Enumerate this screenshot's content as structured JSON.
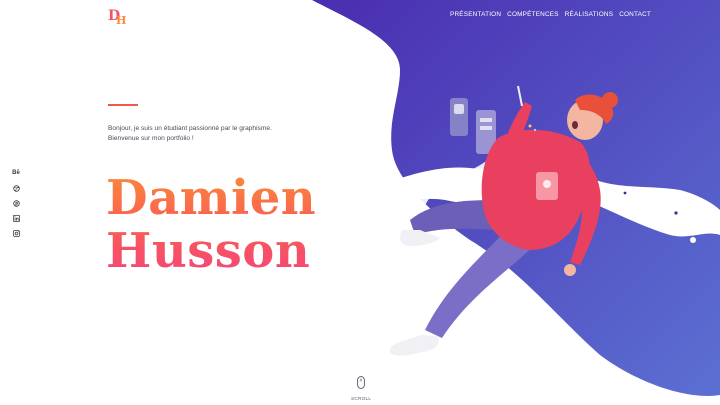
{
  "logo": {
    "icon": "dh-monogram-logo"
  },
  "nav": {
    "items": [
      "PRÉSENTATION",
      "COMPÉTENCES",
      "RÉALISATIONS",
      "CONTACT"
    ]
  },
  "hero": {
    "intro_line1": "Bonjour, je suis un étudiant passionné par le graphisme.",
    "intro_line2": "Bienvenue sur mon portfolio !",
    "first_name": "Damien",
    "last_name": "Husson"
  },
  "social": {
    "items": [
      {
        "label": "Bē",
        "icon": "behance-icon"
      },
      {
        "icon": "dribbble-icon"
      },
      {
        "icon": "pinterest-icon"
      },
      {
        "icon": "linkedin-icon"
      },
      {
        "icon": "instagram-icon"
      }
    ]
  },
  "scroll": {
    "label": "SCROLL",
    "icon": "mouse-icon"
  },
  "colors": {
    "accent": "#f0584c",
    "wave_start": "#4a2fb0",
    "wave_end": "#5b6cd0",
    "name_gradient_top": "#fb8a3c",
    "name_gradient_bottom": "#f4447a"
  }
}
